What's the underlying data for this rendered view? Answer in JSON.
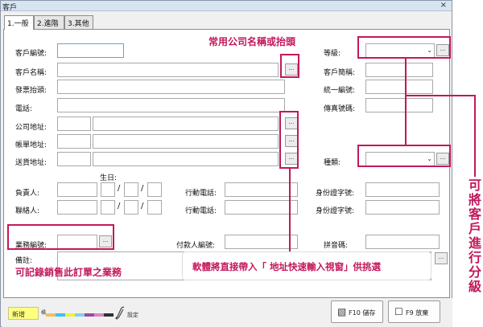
{
  "window": {
    "title": "客戶",
    "close_glyph": "×"
  },
  "tabs": [
    {
      "label": "1.一般"
    },
    {
      "label": "2.進階"
    },
    {
      "label": "3.其他"
    }
  ],
  "form": {
    "customer_no": "客戶編號:",
    "customer_name": "客戶名稱:",
    "invoice_title": "發票抬頭:",
    "phone": "電話:",
    "company_address": "公司地址:",
    "billing_address": "帳單地址:",
    "shipping_address": "送貨地址:",
    "birthday": "生日:",
    "responsible": "負責人:",
    "contact": "聯絡人:",
    "mobile1": "行動電話:",
    "mobile2": "行動電話:",
    "id1": "身份證字號:",
    "id2": "身份證字號:",
    "sales_no": "業務編號:",
    "payer_no": "付款人編號:",
    "pinyin": "拼音碼:",
    "remark": "備註:",
    "grade": "等級:",
    "short_name": "客戶簡稱:",
    "tax_id": "統一編號:",
    "fax": "傳真號碼:",
    "category": "種類:",
    "ellipsis": "...",
    "slash": "/",
    "chevron": "⌄"
  },
  "annotations": {
    "common_names": "常用公司名稱或抬頭",
    "sales": "可記錄銷售此訂單之業務",
    "address_window": "軟體將直接帶入「 地址快速輸入視窗」供挑選",
    "classify": [
      "可",
      "將",
      "客",
      "戶",
      "進",
      "行",
      "分",
      "級"
    ],
    "color": "#c2185b"
  },
  "bottom": {
    "new_label": "新增",
    "color_label": "橘",
    "settings_label": "設定",
    "save_label": "F10 儲存",
    "cancel_label": "F9 放棄",
    "swatches": [
      "#f0c060",
      "#40c0f0",
      "#f0f040",
      "#80d0f0",
      "#9a4aa0",
      "#e080c0",
      "#303030"
    ]
  }
}
